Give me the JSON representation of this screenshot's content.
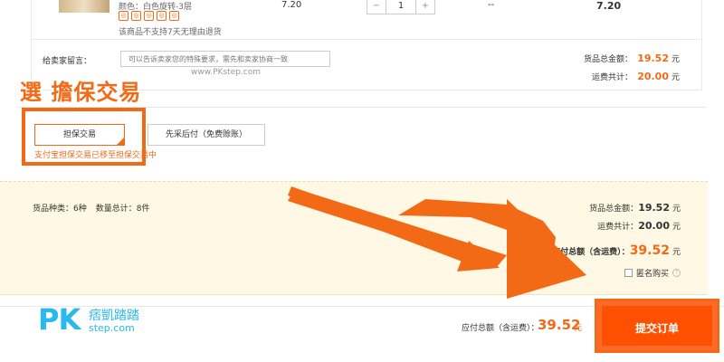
{
  "product": {
    "attr_line": "颜色：白色旋转-3层",
    "badges": [
      "◎",
      "◎",
      "◎",
      "◎",
      "◎"
    ],
    "no_return_text": "该商品不支持7天无理由退货",
    "unit_price": "7.20",
    "qty_minus": "−",
    "qty_value": "1",
    "qty_plus": "+",
    "discount": "--",
    "row_total": "7.20"
  },
  "message": {
    "label": "给卖家留言：",
    "placeholder": "可以告诉卖家您的特殊要求，需先和卖家协商一致",
    "watermark_url": "www.PKstep.com"
  },
  "subtotals": {
    "goods_label": "货品总金额：",
    "goods_amount": "19.52",
    "freight_label": "运费共计：",
    "freight_amount": "20.00",
    "unit": "元"
  },
  "annotation": "選 擔保交易",
  "payment": {
    "option_1": "担保交易",
    "option_2": "先采后付（免费赊账）",
    "note": "支付宝担保交易已移至担保交易中"
  },
  "summary": {
    "kinds_label": "货品种类：",
    "kinds_value": "6种",
    "qty_label": "数量总计：",
    "qty_value": "8件",
    "goods_label": "货品总金额：",
    "goods_amount": "19.52",
    "freight_label": "运费共计：",
    "freight_amount": "20.00",
    "payable_label": "应付总额（含运费）：",
    "payable_amount": "39.52",
    "unit": "元",
    "anon_label": "匿名购买",
    "help": "?"
  },
  "bottom": {
    "payable_label": "应付总额（含运费）：",
    "payable_amount": "39.52",
    "unit": "元",
    "submit_label": "提交订单"
  },
  "logo": {
    "pk": "PK",
    "cn": "痞凱踏踏",
    "en": "step.com"
  },
  "colors": {
    "accent": "#f36a16",
    "submit": "#ff5000",
    "logo": "#28b9f0",
    "summary_bg": "#fff8e4"
  }
}
